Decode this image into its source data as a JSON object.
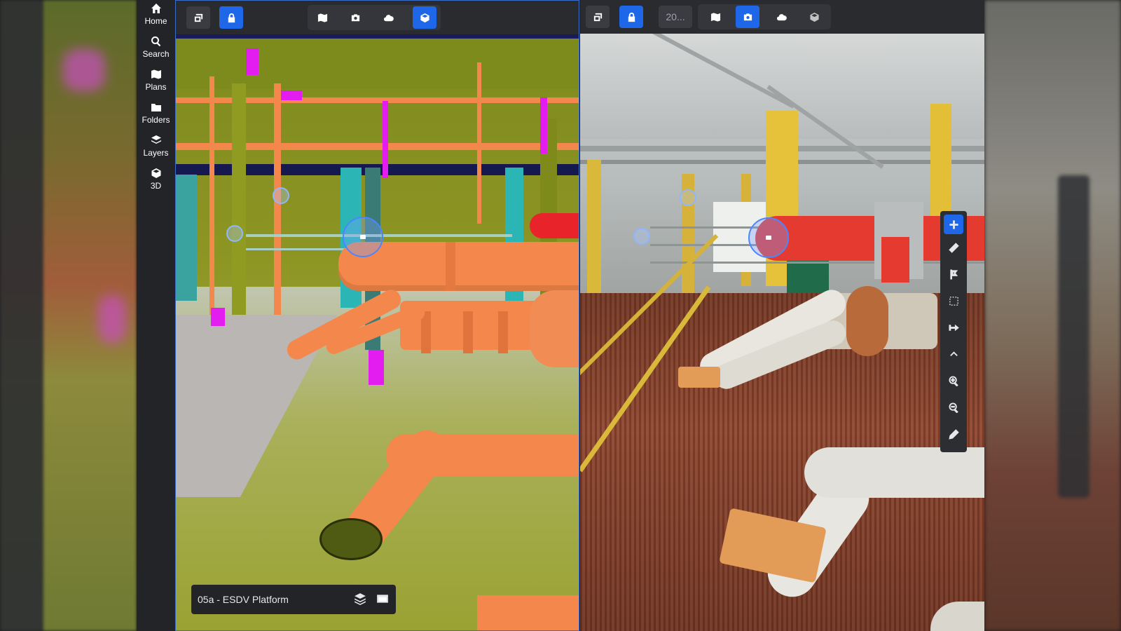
{
  "nav": {
    "items": [
      {
        "id": "home",
        "label": "Home",
        "icon": "home-icon"
      },
      {
        "id": "search",
        "label": "Search",
        "icon": "search-icon"
      },
      {
        "id": "plans",
        "label": "Plans",
        "icon": "map-icon"
      },
      {
        "id": "folders",
        "label": "Folders",
        "icon": "folder-icon"
      },
      {
        "id": "layers",
        "label": "Layers",
        "icon": "layers-icon"
      },
      {
        "id": "3d",
        "label": "3D",
        "icon": "cube-icon"
      }
    ]
  },
  "left_panel": {
    "view_mode": "3D model",
    "scene_name": "05a - ESDV Platform"
  },
  "right_panel": {
    "view_mode": "360 photo",
    "date_truncated": "20..."
  },
  "side_tools": [
    "add-icon",
    "measure-icon",
    "flag-icon",
    "select-box-icon",
    "distance-icon",
    "collapse-icon",
    "zoom-in-icon",
    "zoom-out-icon",
    "edit-icon"
  ],
  "colors": {
    "accent": "#1f67e9",
    "bim_pipe": "#f4874b",
    "bim_steel": "#8f9b21",
    "bim_magenta": "#e31cf0",
    "toolbar_bg": "#2a2b2f",
    "nav_bg": "#232427"
  }
}
